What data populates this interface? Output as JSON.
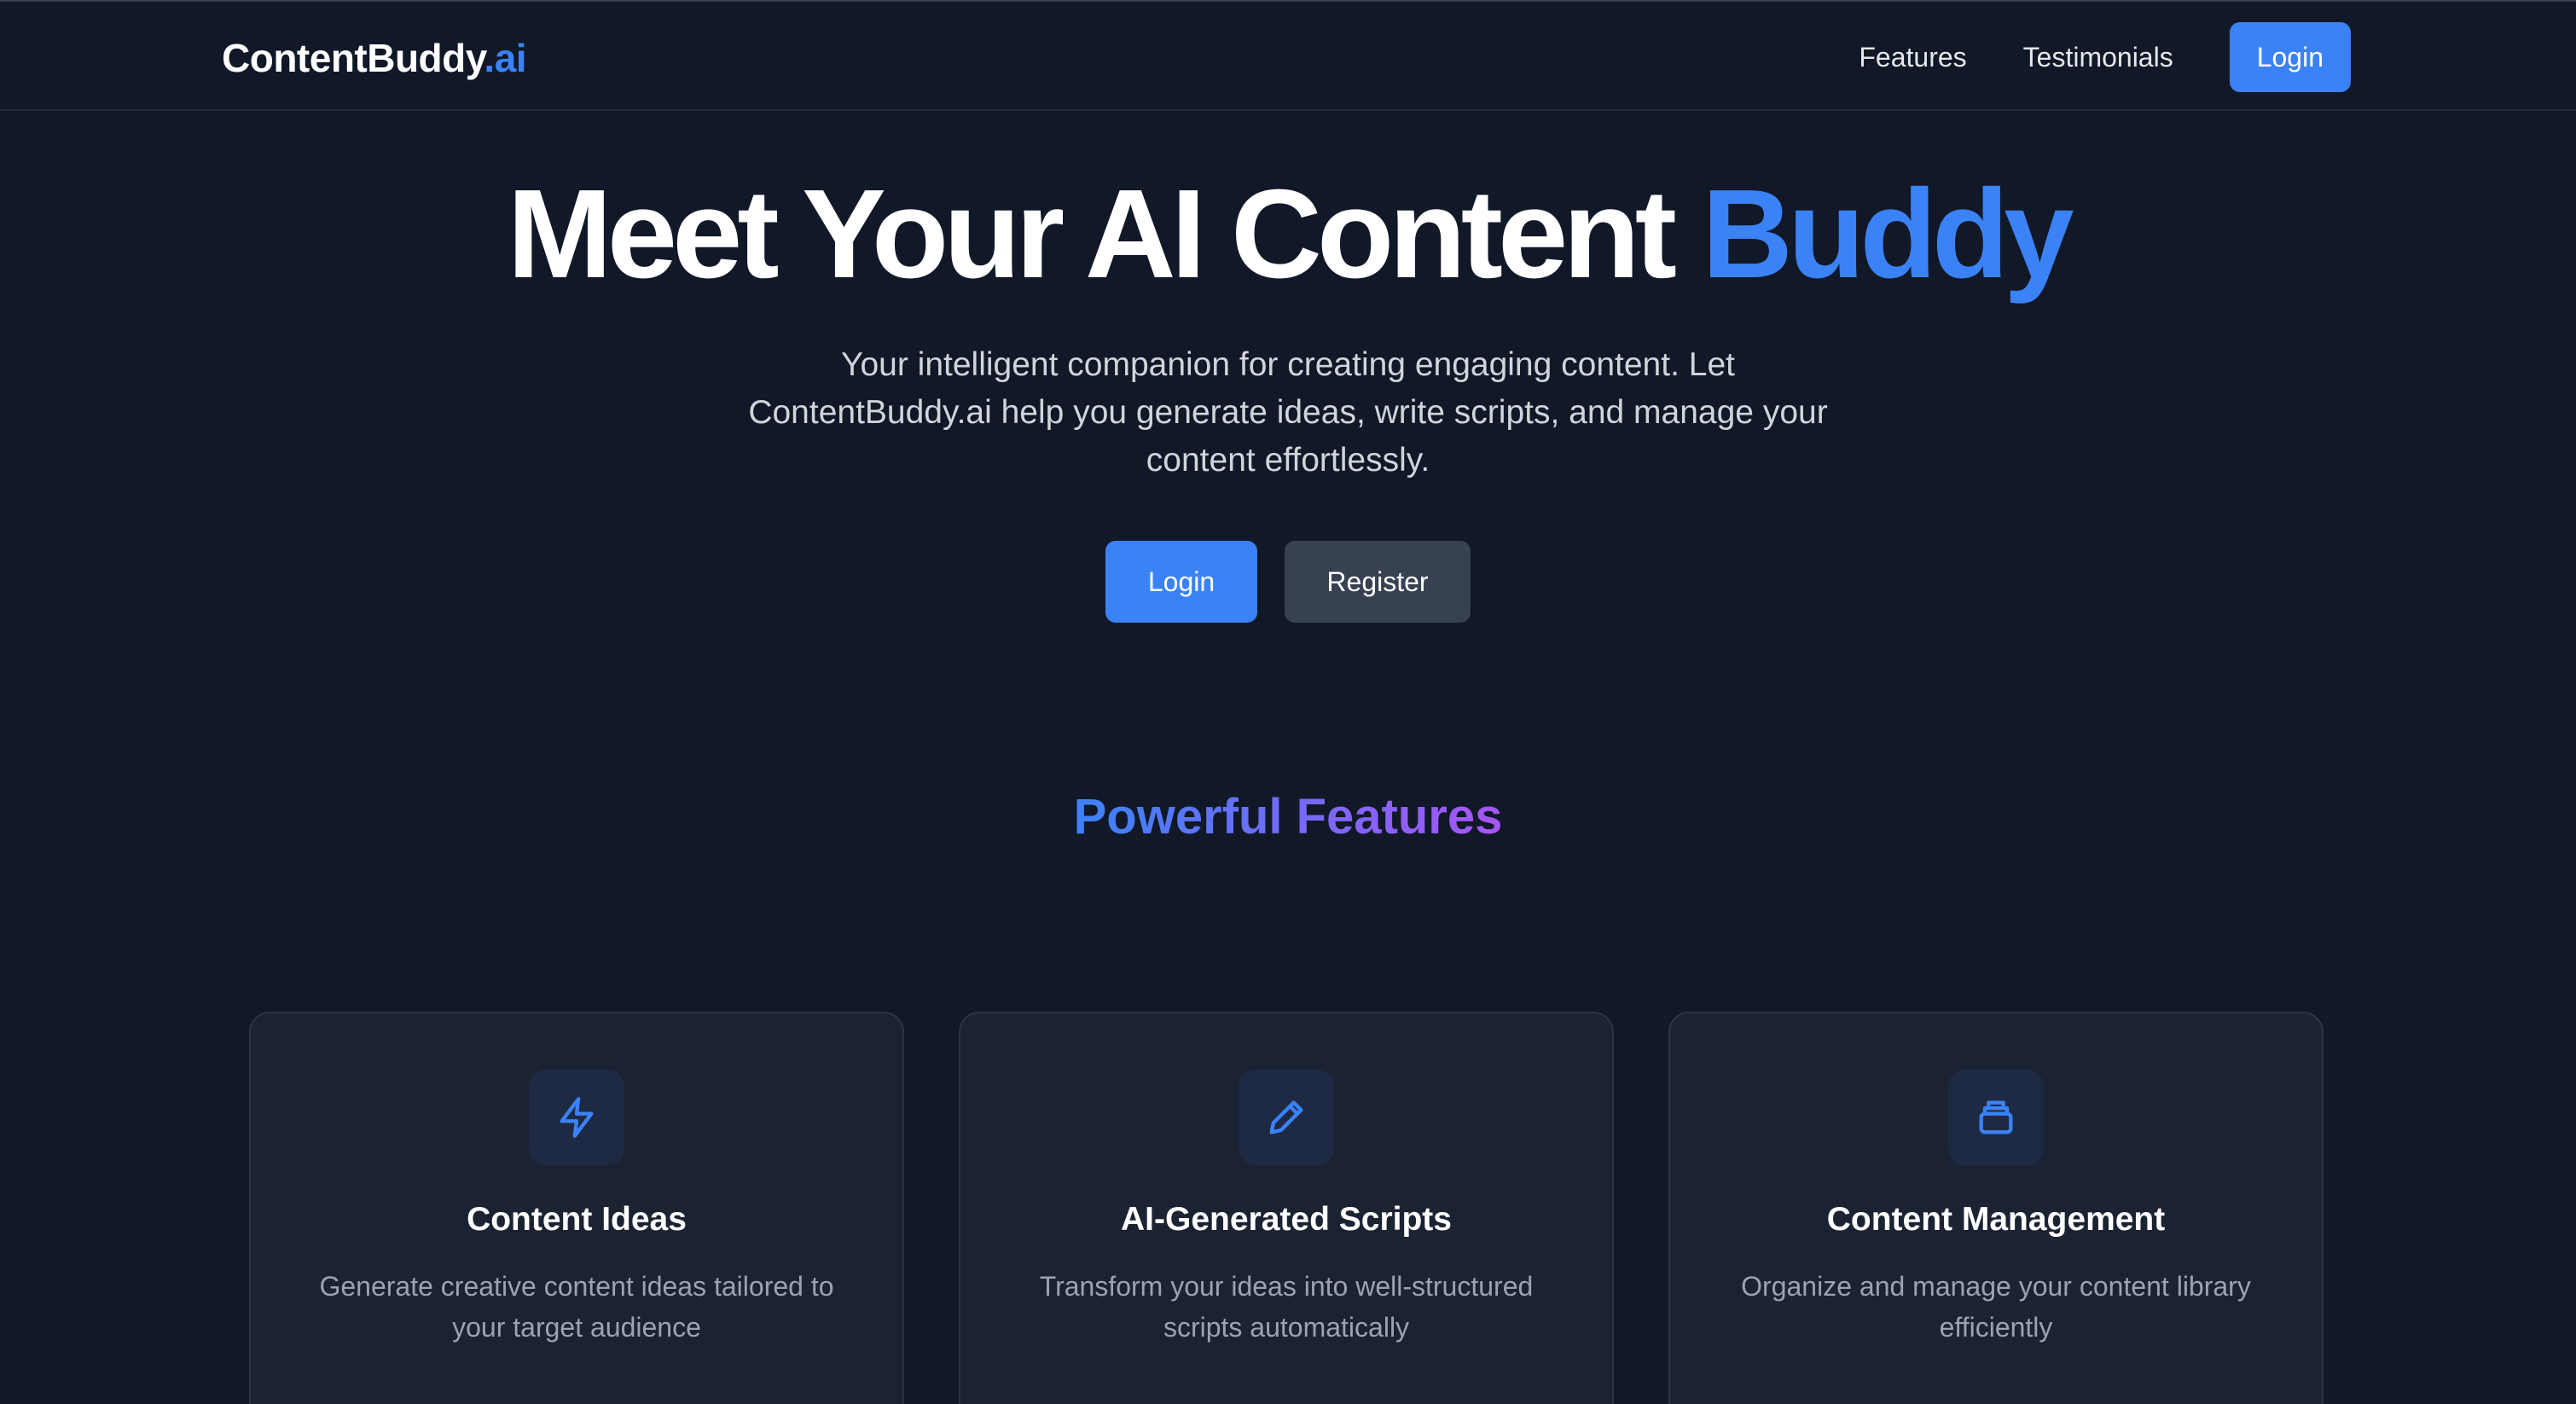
{
  "nav": {
    "logo_main": "ContentBuddy",
    "logo_accent": ".ai",
    "links": [
      "Features",
      "Testimonials"
    ],
    "login_label": "Login"
  },
  "hero": {
    "title_main": "Meet Your AI Content ",
    "title_accent": "Buddy",
    "subtitle": "Your intelligent companion for creating engaging content. Let ContentBuddy.ai help you generate ideas, write scripts, and manage your content effortlessly.",
    "login_label": "Login",
    "register_label": "Register"
  },
  "features": {
    "heading": "Powerful Features",
    "cards": [
      {
        "icon": "lightning-icon",
        "title": "Content Ideas",
        "description": "Generate creative content ideas tailored to your target audience"
      },
      {
        "icon": "pencil-icon",
        "title": "AI-Generated Scripts",
        "description": "Transform your ideas into well-structured scripts automatically"
      },
      {
        "icon": "archive-icon",
        "title": "Content Management",
        "description": "Organize and manage your content library efficiently"
      }
    ]
  },
  "colors": {
    "background": "#111827",
    "accent": "#3b82f6",
    "gradient_end": "#a855f7",
    "card_background": "#1b2332",
    "secondary_button": "#374151"
  }
}
